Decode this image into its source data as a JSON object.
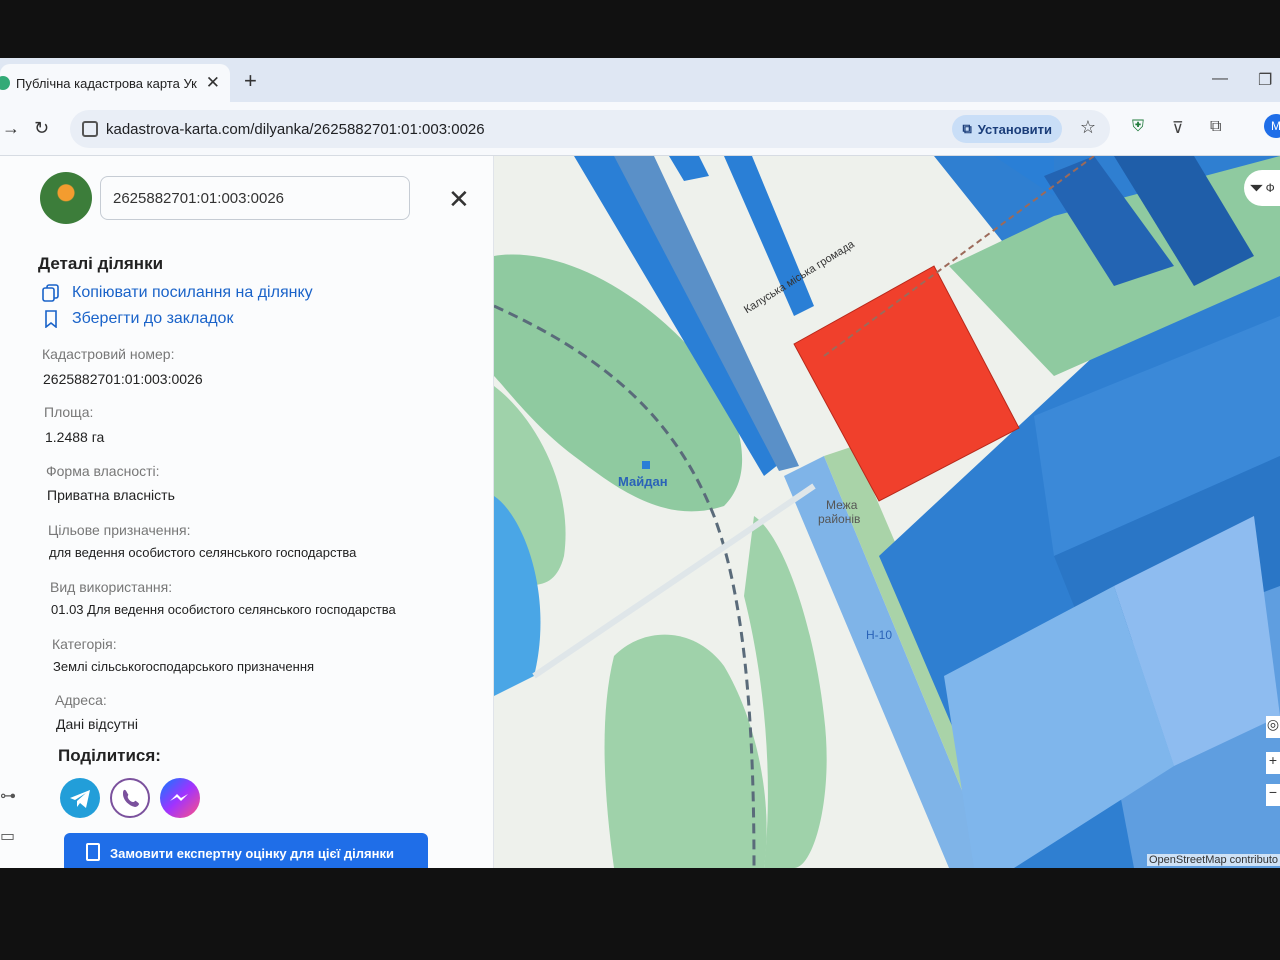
{
  "browser": {
    "tab_title": "Публічна кадастрова карта Ук",
    "tab_close": "✕",
    "new_tab": "+",
    "url": "kadastrova-karta.com/dilyanka/2625882701:01:003:0026",
    "install_label": "Установити",
    "profile_initial": "М"
  },
  "panel": {
    "search_value": "2625882701:01:003:0026",
    "details_heading": "Деталі ділянки",
    "copy_link": "Копіювати посилання на ділянку",
    "bookmark": "Зберегти до закладок",
    "fields": [
      {
        "label": "Кадастровий номер:",
        "value": "2625882701:01:003:0026"
      },
      {
        "label": "Площа:",
        "value": "1.2488 га"
      },
      {
        "label": "Форма власності:",
        "value": "Приватна власність"
      },
      {
        "label": "Цільове призначення:",
        "value": "для ведення особистого селянського господарства"
      },
      {
        "label": "Вид використання:",
        "value": "01.03 Для ведення особистого селянського господарства"
      },
      {
        "label": "Категорія:",
        "value": "Землі сільськогосподарського призначення"
      },
      {
        "label": "Адреса:",
        "value": "Дані відсутні"
      }
    ],
    "share_heading": "Поділитися:",
    "share_icons": [
      "telegram-icon",
      "viber-icon",
      "messenger-icon"
    ],
    "order_button": "Замовити експертну оцінку для цієї ділянки"
  },
  "map": {
    "labels": {
      "station": "Майдан",
      "boundary_1": "Межа",
      "boundary_2": "районів",
      "road": "Н-10",
      "hromada": "Калуська міська громада"
    },
    "filter_label": "Ф",
    "attribution": "OpenStreetMap contributo",
    "selected_parcel_color": "#f0402c"
  }
}
